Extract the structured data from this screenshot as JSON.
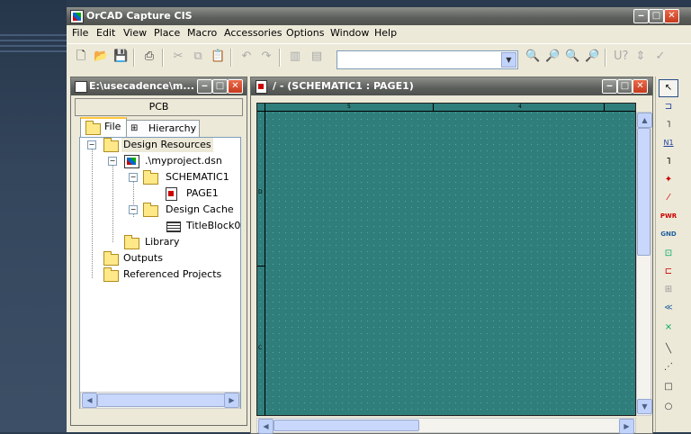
{
  "app": {
    "title": "OrCAD Capture CIS",
    "window_buttons": {
      "minimize": "‒",
      "maximize": "□",
      "close": "✕"
    }
  },
  "menu": [
    "File",
    "Edit",
    "View",
    "Place",
    "Macro",
    "Accessories",
    "Options",
    "Window",
    "Help"
  ],
  "toolbar": {
    "combo_value": "",
    "icons": [
      "new-icon",
      "open-icon",
      "save-icon",
      "print-icon",
      "cut-icon",
      "copy-icon",
      "paste-icon",
      "undo-icon",
      "redo-icon",
      "tile-icon",
      "cascade-icon",
      "find-icon",
      "find-next-icon",
      "zoom-icon",
      "zoom-area-icon",
      "help-query-icon",
      "snap-icon",
      "check-icon"
    ]
  },
  "project_window": {
    "title": "E:\\usecadence\\m...",
    "pcb_label": "PCB",
    "tabs": [
      {
        "label": "File",
        "active": true
      },
      {
        "label": "Hierarchy",
        "active": false
      }
    ],
    "tree": [
      {
        "label": "Design Resources",
        "icon": "folder-icon",
        "level": 0,
        "expander": "−",
        "highlight": true
      },
      {
        "label": ".\\myproject.dsn",
        "icon": "design-file-icon",
        "level": 1,
        "expander": "−"
      },
      {
        "label": "SCHEMATIC1",
        "icon": "schematic-folder-icon",
        "level": 2,
        "expander": "−"
      },
      {
        "label": "PAGE1",
        "icon": "page-icon",
        "level": 3,
        "expander": ""
      },
      {
        "label": "Design Cache",
        "icon": "folder-icon",
        "level": 2,
        "expander": "−"
      },
      {
        "label": "TitleBlock0",
        "icon": "titleblock-icon",
        "level": 3,
        "expander": ""
      },
      {
        "label": "Library",
        "icon": "folder-icon",
        "level": 1,
        "expander": ""
      },
      {
        "label": "Outputs",
        "icon": "folder-icon",
        "level": 0,
        "expander": ""
      },
      {
        "label": "Referenced Projects",
        "icon": "folder-icon",
        "level": 0,
        "expander": ""
      }
    ]
  },
  "schematic_window": {
    "title": "/ - (SCHEMATIC1 : PAGE1)",
    "ruler_top_labels": [
      "5",
      "4"
    ],
    "ruler_left_labels": [
      "D",
      "C"
    ],
    "canvas_color": "#2f7e7c"
  },
  "palette": [
    "select-icon",
    "place-part-icon",
    "place-wire-icon",
    "place-net-alias-icon",
    "place-bus-icon",
    "place-junction-icon",
    "place-bus-entry-icon",
    "place-power-icon",
    "place-ground-icon",
    "place-hierarchical-block-icon",
    "place-port-icon",
    "place-pin-icon",
    "place-off-page-icon",
    "place-no-connect-icon",
    "place-line-icon",
    "place-polyline-icon",
    "place-rectangle-icon",
    "place-ellipse-icon"
  ],
  "palette_labels": {
    "power": "PWR",
    "ground": "GND",
    "net": "N1"
  }
}
